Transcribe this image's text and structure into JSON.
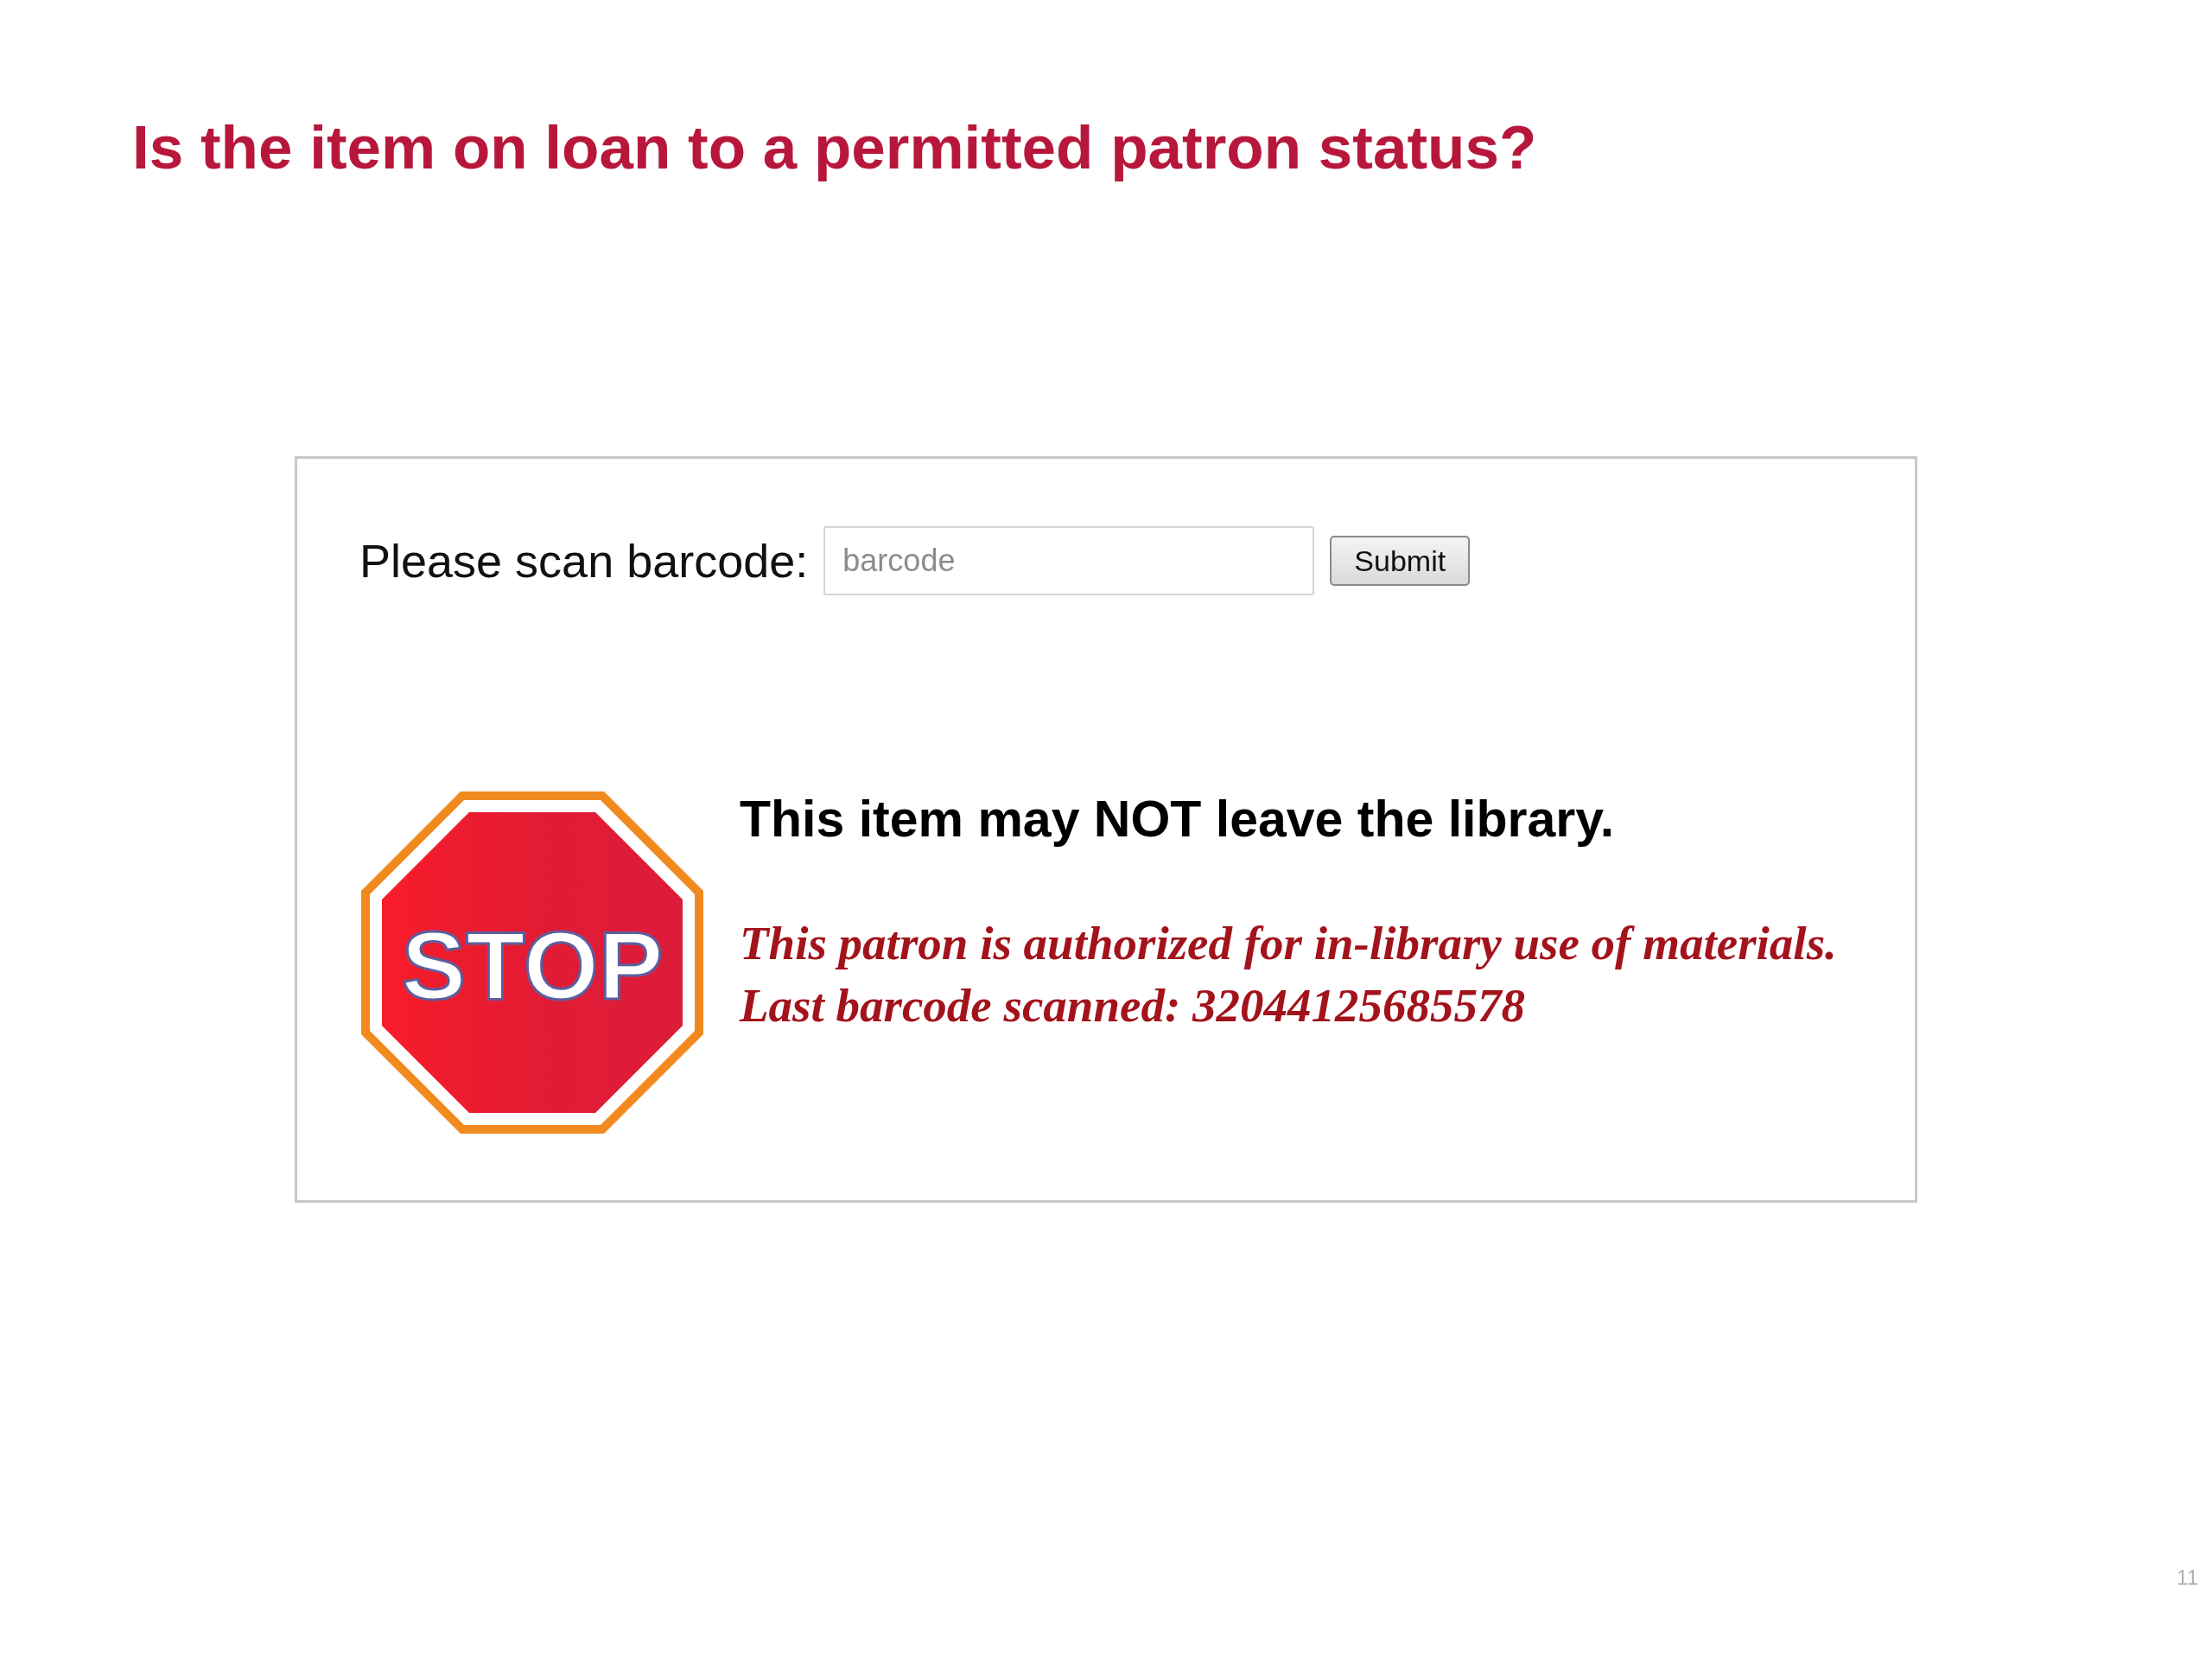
{
  "slide_title": "Is the item on loan to a permitted patron status?",
  "screen": {
    "scan_label": "Please scan barcode:",
    "barcode_field": {
      "placeholder": "barcode"
    },
    "submit_button": "Submit",
    "stop_sign": "STOP",
    "heading": "This item may NOT leave the library.",
    "messages": [
      "This patron is authorized for in-library use of materials.",
      "Last barcode scanned: 32044125685578"
    ]
  },
  "page_number": "11"
}
